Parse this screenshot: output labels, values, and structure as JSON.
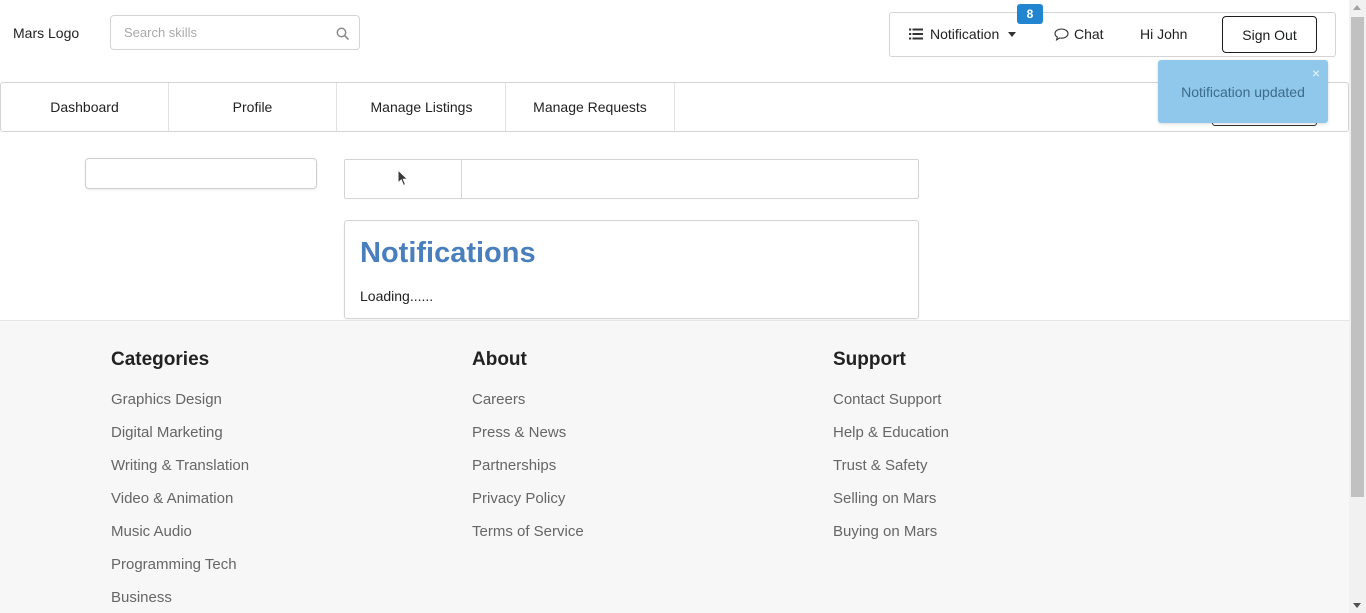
{
  "header": {
    "logo": "Mars Logo",
    "search_placeholder": "Search skills",
    "notification_label": "Notification",
    "notification_count": "8",
    "chat_label": "Chat",
    "greeting": "Hi John",
    "signout_label": "Sign Out"
  },
  "nav": {
    "tabs": [
      {
        "label": "Dashboard"
      },
      {
        "label": "Profile"
      },
      {
        "label": "Manage Listings"
      },
      {
        "label": "Manage Requests"
      }
    ]
  },
  "toast": {
    "message": "Notification updated",
    "close": "×"
  },
  "main": {
    "notifications_title": "Notifications",
    "loading_text": "Loading......"
  },
  "footer": {
    "columns": [
      {
        "heading": "Categories",
        "links": [
          "Graphics Design",
          "Digital Marketing",
          "Writing & Translation",
          "Video & Animation",
          "Music Audio",
          "Programming Tech",
          "Business"
        ]
      },
      {
        "heading": "About",
        "links": [
          "Careers",
          "Press & News",
          "Partnerships",
          "Privacy Policy",
          "Terms of Service"
        ]
      },
      {
        "heading": "Support",
        "links": [
          "Contact Support",
          "Help & Education",
          "Trust & Safety",
          "Selling on Mars",
          "Buying on Mars"
        ]
      }
    ]
  },
  "colors": {
    "accent": "#2185d0",
    "toast_bg": "#8fc8ea",
    "title_blue": "#4a7fbd",
    "footer_bg": "#f7f7f7"
  }
}
